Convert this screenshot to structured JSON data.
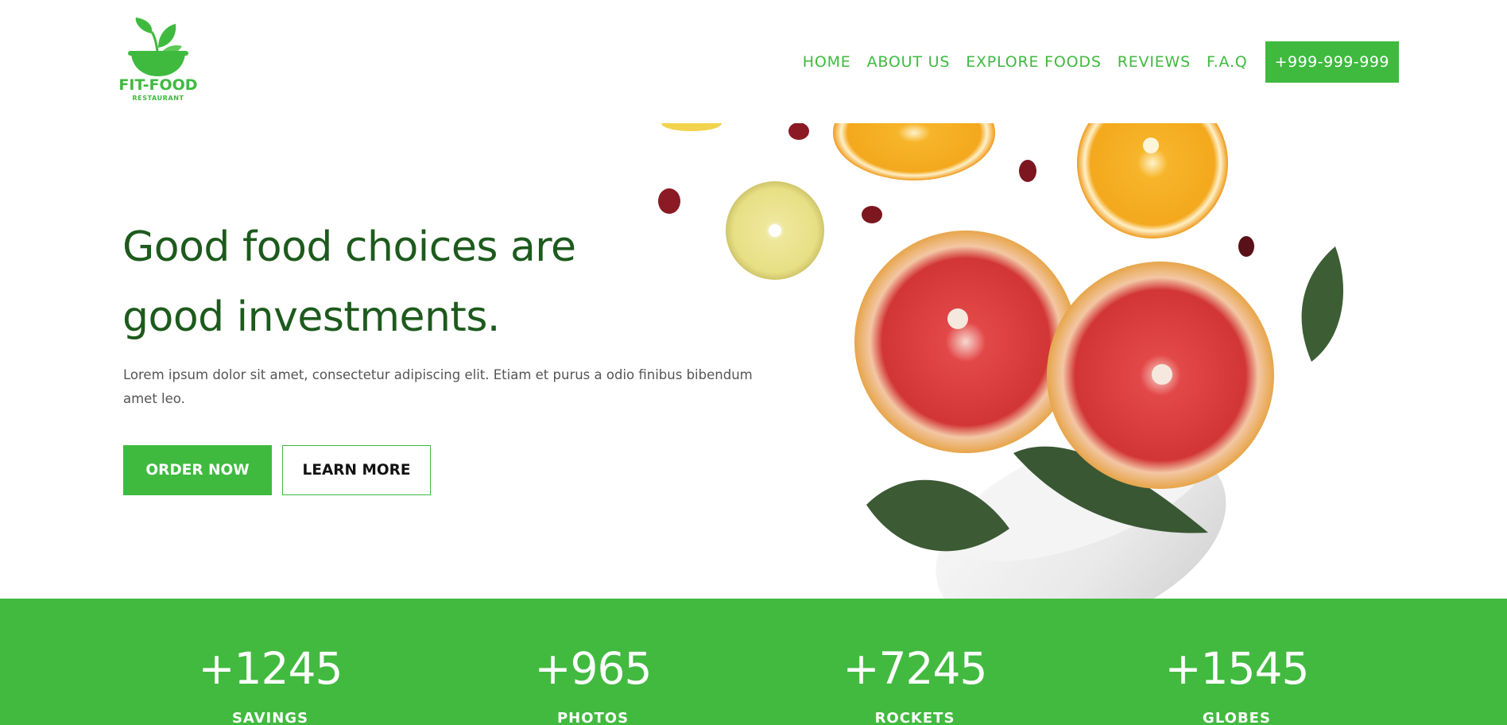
{
  "brand": {
    "name": "FIT-FOOD",
    "tagline": "RESTAURANT",
    "logo_icon": "leaf-bowl-icon",
    "color": "#3fba3f"
  },
  "nav": {
    "items": [
      {
        "label": "HOME"
      },
      {
        "label": "ABOUT US"
      },
      {
        "label": "EXPLORE FOODS"
      },
      {
        "label": "REVIEWS"
      },
      {
        "label": "F.A.Q"
      }
    ],
    "phone": "+999-999-999"
  },
  "hero": {
    "title_line1": "Good food choices are",
    "title_line2": "good investments.",
    "text_line1": "Lorem ipsum dolor sit amet, consectetur adipiscing elit. Etiam et purus a odio finibus bibendum",
    "text_line2": "amet leo.",
    "order_button": "ORDER NOW",
    "learn_button": "LEARN MORE",
    "title_color": "#1d5a1d"
  },
  "stats": {
    "background": "#42ba40",
    "items": [
      {
        "value": "+1245",
        "label": "SAVINGS"
      },
      {
        "value": "+965",
        "label": "PHOTOS"
      },
      {
        "value": "+7245",
        "label": "ROCKETS"
      },
      {
        "value": "+1545",
        "label": "GLOBES"
      }
    ]
  }
}
